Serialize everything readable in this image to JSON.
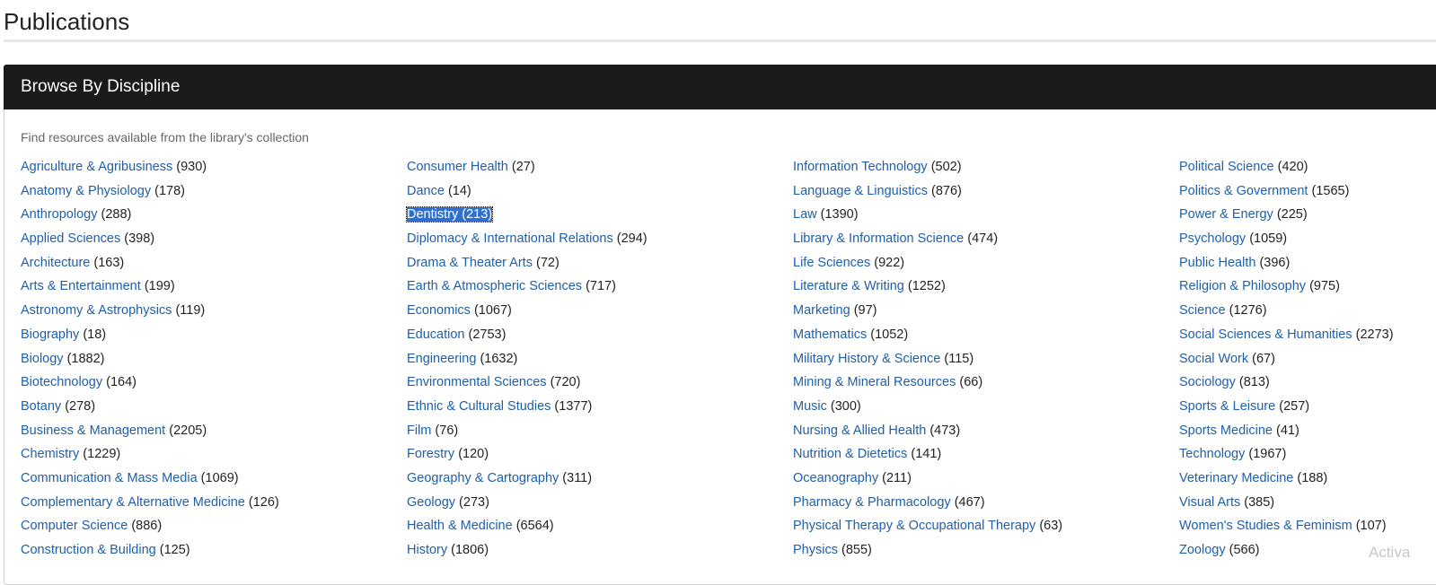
{
  "page": {
    "title": "Publications"
  },
  "panel": {
    "heading": "Browse By Discipline",
    "intro": "Find resources available from the library's collection"
  },
  "columns": [
    [
      {
        "label": "Agriculture & Agribusiness",
        "count": "(930)"
      },
      {
        "label": "Anatomy & Physiology",
        "count": "(178)"
      },
      {
        "label": "Anthropology",
        "count": "(288)"
      },
      {
        "label": "Applied Sciences",
        "count": "(398)"
      },
      {
        "label": "Architecture",
        "count": "(163)"
      },
      {
        "label": "Arts & Entertainment",
        "count": "(199)"
      },
      {
        "label": "Astronomy & Astrophysics",
        "count": "(119)"
      },
      {
        "label": "Biography",
        "count": "(18)"
      },
      {
        "label": "Biology",
        "count": "(1882)"
      },
      {
        "label": "Biotechnology",
        "count": "(164)"
      },
      {
        "label": "Botany",
        "count": "(278)"
      },
      {
        "label": "Business & Management",
        "count": "(2205)"
      },
      {
        "label": "Chemistry",
        "count": "(1229)"
      },
      {
        "label": "Communication & Mass Media",
        "count": "(1069)"
      },
      {
        "label": "Complementary & Alternative Medicine",
        "count": "(126)"
      },
      {
        "label": "Computer Science",
        "count": "(886)"
      },
      {
        "label": "Construction & Building",
        "count": "(125)"
      }
    ],
    [
      {
        "label": "Consumer Health",
        "count": "(27)"
      },
      {
        "label": "Dance",
        "count": "(14)"
      },
      {
        "label": "Dentistry",
        "count": "(213)"
      },
      {
        "label": "Diplomacy & International Relations",
        "count": "(294)"
      },
      {
        "label": "Drama & Theater Arts",
        "count": "(72)"
      },
      {
        "label": "Earth & Atmospheric Sciences",
        "count": "(717)"
      },
      {
        "label": "Economics",
        "count": "(1067)"
      },
      {
        "label": "Education",
        "count": "(2753)"
      },
      {
        "label": "Engineering",
        "count": "(1632)"
      },
      {
        "label": "Environmental Sciences",
        "count": "(720)"
      },
      {
        "label": "Ethnic & Cultural Studies",
        "count": "(1377)"
      },
      {
        "label": "Film",
        "count": "(76)"
      },
      {
        "label": "Forestry",
        "count": "(120)"
      },
      {
        "label": "Geography & Cartography",
        "count": "(311)"
      },
      {
        "label": "Geology",
        "count": "(273)"
      },
      {
        "label": "Health & Medicine",
        "count": "(6564)"
      },
      {
        "label": "History",
        "count": "(1806)"
      }
    ],
    [
      {
        "label": "Information Technology",
        "count": "(502)"
      },
      {
        "label": "Language & Linguistics",
        "count": "(876)"
      },
      {
        "label": "Law",
        "count": "(1390)"
      },
      {
        "label": "Library & Information Science",
        "count": "(474)"
      },
      {
        "label": "Life Sciences",
        "count": "(922)"
      },
      {
        "label": "Literature & Writing",
        "count": "(1252)"
      },
      {
        "label": "Marketing",
        "count": "(97)"
      },
      {
        "label": "Mathematics",
        "count": "(1052)"
      },
      {
        "label": "Military History & Science",
        "count": "(115)"
      },
      {
        "label": "Mining & Mineral Resources",
        "count": "(66)"
      },
      {
        "label": "Music",
        "count": "(300)"
      },
      {
        "label": "Nursing & Allied Health",
        "count": "(473)"
      },
      {
        "label": "Nutrition & Dietetics",
        "count": "(141)"
      },
      {
        "label": "Oceanography",
        "count": "(211)"
      },
      {
        "label": "Pharmacy & Pharmacology",
        "count": "(467)"
      },
      {
        "label": "Physical Therapy & Occupational Therapy",
        "count": "(63)"
      },
      {
        "label": "Physics",
        "count": "(855)"
      }
    ],
    [
      {
        "label": "Political Science",
        "count": "(420)"
      },
      {
        "label": "Politics & Government",
        "count": "(1565)"
      },
      {
        "label": "Power & Energy",
        "count": "(225)"
      },
      {
        "label": "Psychology",
        "count": "(1059)"
      },
      {
        "label": "Public Health",
        "count": "(396)"
      },
      {
        "label": "Religion & Philosophy",
        "count": "(975)"
      },
      {
        "label": "Science",
        "count": "(1276)"
      },
      {
        "label": "Social Sciences & Humanities",
        "count": "(2273)"
      },
      {
        "label": "Social Work",
        "count": "(67)"
      },
      {
        "label": "Sociology",
        "count": "(813)"
      },
      {
        "label": "Sports & Leisure",
        "count": "(257)"
      },
      {
        "label": "Sports Medicine",
        "count": "(41)"
      },
      {
        "label": "Technology",
        "count": "(1967)"
      },
      {
        "label": "Veterinary Medicine",
        "count": "(188)"
      },
      {
        "label": "Visual Arts",
        "count": "(385)"
      },
      {
        "label": "Women's Studies & Feminism",
        "count": "(107)"
      },
      {
        "label": "Zoology",
        "count": "(566)"
      }
    ]
  ],
  "selected": "Dentistry",
  "colors": {
    "link": "#1f5fa8",
    "heading_bg": "#1b1b1b",
    "selection": "#2f6fd0"
  },
  "watermark": "Activa"
}
